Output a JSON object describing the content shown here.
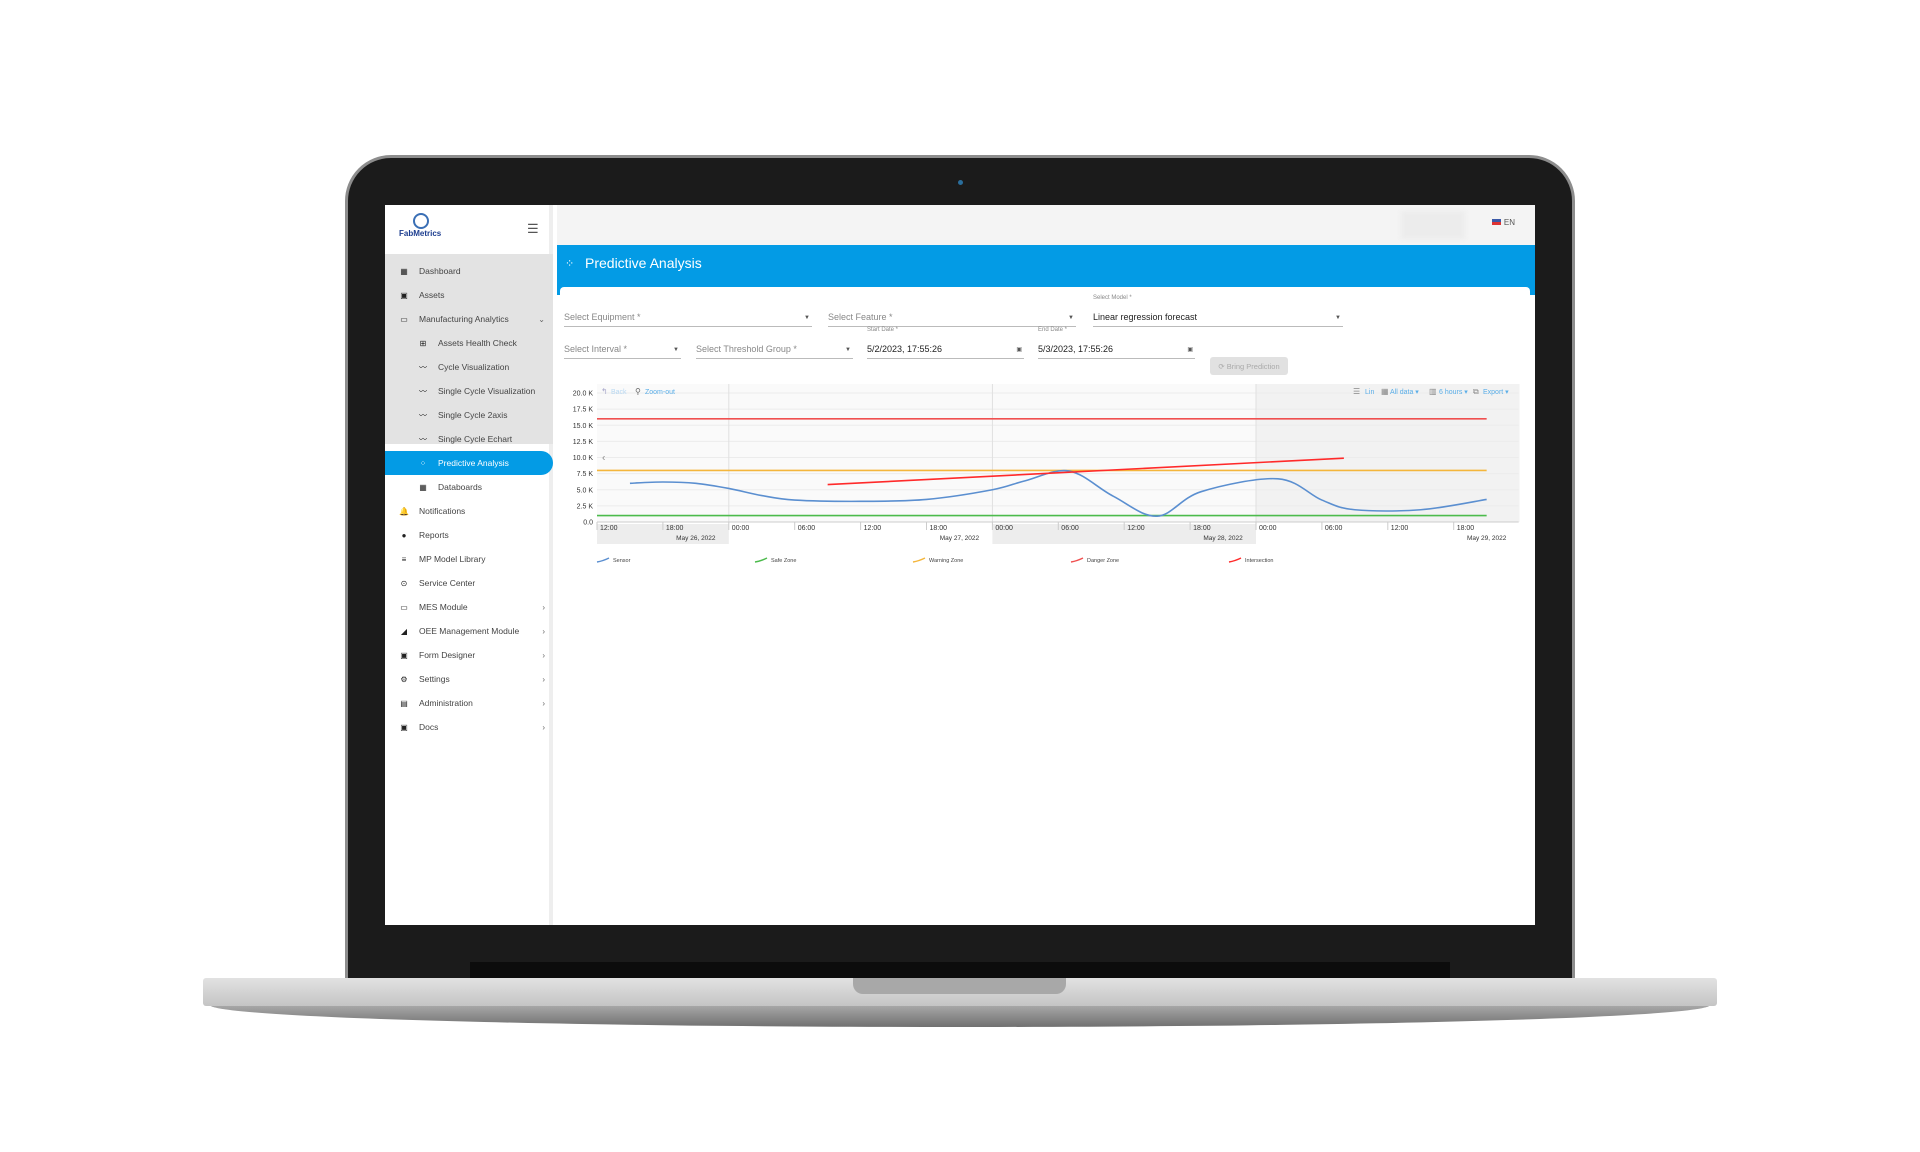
{
  "app": {
    "brand": "FabMetrics",
    "language": "EN"
  },
  "sidebar": {
    "items": [
      {
        "label": "Dashboard",
        "icon": "dashboard-icon",
        "glyph": "▦"
      },
      {
        "label": "Assets",
        "icon": "assets-icon",
        "glyph": "▣"
      },
      {
        "label": "Manufacturing Analytics",
        "icon": "monitor-icon",
        "glyph": "▭",
        "chevron": "⌄",
        "group": true
      },
      {
        "label": "Assets Health Check",
        "icon": "health-check-icon",
        "glyph": "⊞",
        "sub": true
      },
      {
        "label": "Cycle Visualization",
        "icon": "line-chart-icon",
        "glyph": "〰",
        "sub": true
      },
      {
        "label": "Single Cycle Visualization",
        "icon": "line-chart-icon",
        "glyph": "〰",
        "sub": true
      },
      {
        "label": "Single Cycle 2axis",
        "icon": "line-chart-icon",
        "glyph": "〰",
        "sub": true
      },
      {
        "label": "Single Cycle Echart",
        "icon": "line-chart-icon",
        "glyph": "〰",
        "sub": true
      },
      {
        "label": "Predictive Analysis",
        "icon": "predictive-icon",
        "glyph": "⁘",
        "sub": true,
        "active": true
      },
      {
        "label": "Databoards",
        "icon": "databoards-icon",
        "glyph": "▦",
        "sub": true
      },
      {
        "label": "Notifications",
        "icon": "bell-icon",
        "glyph": "🔔"
      },
      {
        "label": "Reports",
        "icon": "reports-icon",
        "glyph": "●"
      },
      {
        "label": "MP Model Library",
        "icon": "list-icon",
        "glyph": "≡"
      },
      {
        "label": "Service Center",
        "icon": "service-icon",
        "glyph": "⊙"
      },
      {
        "label": "MES Module",
        "icon": "mes-icon",
        "glyph": "▭",
        "chevron": "›"
      },
      {
        "label": "OEE Management Module",
        "icon": "oee-icon",
        "glyph": "◢",
        "chevron": "›"
      },
      {
        "label": "Form Designer",
        "icon": "form-icon",
        "glyph": "▣",
        "chevron": "›"
      },
      {
        "label": "Settings",
        "icon": "gear-icon",
        "glyph": "⚙",
        "chevron": "›"
      },
      {
        "label": "Administration",
        "icon": "admin-icon",
        "glyph": "▤",
        "chevron": "›"
      },
      {
        "label": "Docs",
        "icon": "docs-icon",
        "glyph": "▣",
        "chevron": "›"
      }
    ]
  },
  "page": {
    "title": "Predictive Analysis"
  },
  "form": {
    "equipment": {
      "placeholder": "Select Equipment *"
    },
    "feature": {
      "placeholder": "Select Feature *"
    },
    "model": {
      "label": "Select Model *",
      "value": "Linear regression forecast"
    },
    "interval": {
      "placeholder": "Select Interval *"
    },
    "threshold": {
      "placeholder": "Select Threshold Group *"
    },
    "start": {
      "label": "Start Date *",
      "value": "5/2/2023, 17:55:26"
    },
    "end": {
      "label": "End Date *",
      "value": "5/3/2023, 17:55:26"
    },
    "bring_label": "Bring Prediction"
  },
  "chart_toolbar": {
    "back": "Back",
    "zoom_out": "Zoom-out",
    "lin": "Lin",
    "all_data": "All data ▾",
    "hours": "6 hours ▾",
    "export": "Export ▾"
  },
  "chart_data": {
    "type": "line",
    "ylim": [
      0,
      20000
    ],
    "yticks": [
      "0.0",
      "2.5 K",
      "5.0 K",
      "7.5 K",
      "10.0 K",
      "12.5 K",
      "15.0 K",
      "17.5 K",
      "20.0 K"
    ],
    "xlim": [
      "2022-05-26T12:00",
      "2022-05-29T23:00"
    ],
    "xticks": [
      "12:00",
      "18:00",
      "00:00",
      "06:00",
      "12:00",
      "18:00",
      "00:00",
      "06:00",
      "12:00",
      "18:00",
      "00:00",
      "06:00",
      "12:00",
      "18:00"
    ],
    "date_labels": [
      "May 26, 2022",
      "May 27, 2022",
      "May 28, 2022",
      "May 29, 2022"
    ],
    "grid": true,
    "legend": "bottom",
    "series": [
      {
        "name": "Sensor",
        "color": "#5b8fd0",
        "smooth": true,
        "points": [
          [
            "2022-05-26T15:00",
            6000
          ],
          [
            "2022-05-26T18:00",
            6200
          ],
          [
            "2022-05-26T21:00",
            6000
          ],
          [
            "2022-05-27T00:00",
            5200
          ],
          [
            "2022-05-27T03:00",
            4100
          ],
          [
            "2022-05-27T06:00",
            3400
          ],
          [
            "2022-05-27T12:00",
            3200
          ],
          [
            "2022-05-27T18:00",
            3500
          ],
          [
            "2022-05-28T00:00",
            5000
          ],
          [
            "2022-05-28T03:00",
            6400
          ],
          [
            "2022-05-28T07:00",
            7900
          ],
          [
            "2022-05-28T11:00",
            4000
          ],
          [
            "2022-05-28T15:00",
            900
          ],
          [
            "2022-05-28T19:00",
            4700
          ],
          [
            "2022-05-29T02:00",
            6700
          ],
          [
            "2022-05-29T06:00",
            3400
          ],
          [
            "2022-05-29T09:00",
            1900
          ],
          [
            "2022-05-29T15:00",
            1900
          ],
          [
            "2022-05-29T21:00",
            3500
          ]
        ]
      },
      {
        "name": "Safe Zone",
        "color": "#4cbb4c",
        "points": [
          [
            "2022-05-26T12:00",
            1000
          ],
          [
            "2022-05-29T21:00",
            1000
          ]
        ]
      },
      {
        "name": "Warning Zone",
        "color": "#f4b63c",
        "points": [
          [
            "2022-05-26T12:00",
            8000
          ],
          [
            "2022-05-29T21:00",
            8000
          ]
        ]
      },
      {
        "name": "Danger Zone",
        "color": "#f05050",
        "points": [
          [
            "2022-05-26T12:00",
            16000
          ],
          [
            "2022-05-29T21:00",
            16000
          ]
        ]
      },
      {
        "name": "Intersection",
        "color": "#ff2a2a",
        "points": [
          [
            "2022-05-27T09:00",
            5800
          ],
          [
            "2022-05-29T08:00",
            9900
          ]
        ]
      }
    ]
  }
}
